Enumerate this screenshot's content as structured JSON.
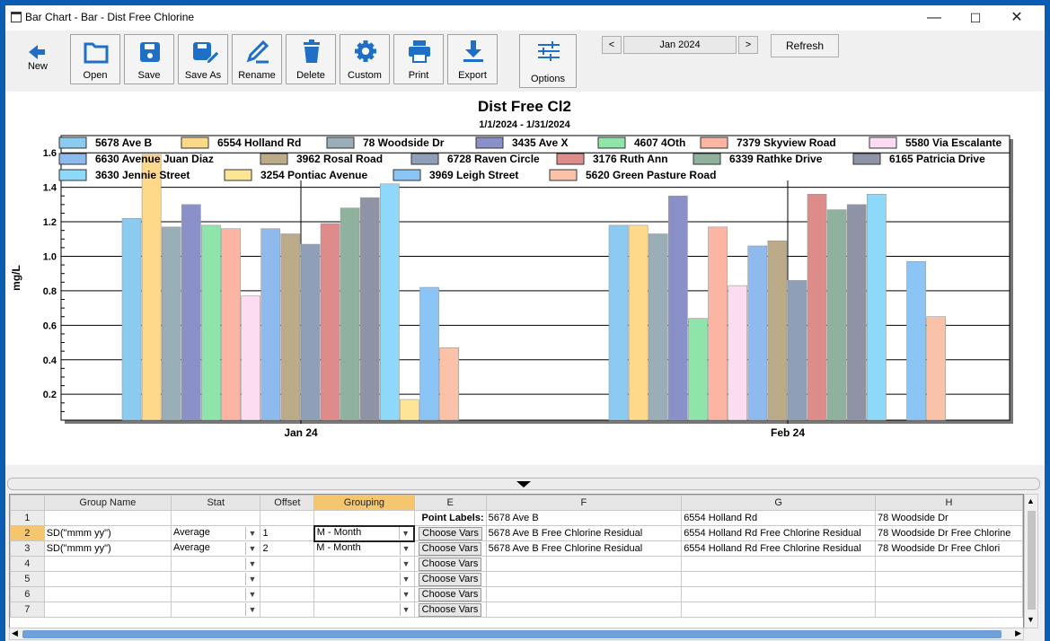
{
  "window": {
    "title": "Bar Chart - Bar - Dist Free Chlorine",
    "minimize": "—",
    "maximize": "☐",
    "close": "✕"
  },
  "toolbar": {
    "buttons": [
      {
        "label": "New",
        "icon": "arrow-left-icon"
      },
      {
        "label": "Open",
        "icon": "folder-icon"
      },
      {
        "label": "Save",
        "icon": "floppy-icon"
      },
      {
        "label": "Save As",
        "icon": "floppy-pencil-icon"
      },
      {
        "label": "Rename",
        "icon": "pencil-icon"
      },
      {
        "label": "Delete",
        "icon": "trash-icon"
      },
      {
        "label": "Custom",
        "icon": "gear-icon"
      },
      {
        "label": "Print",
        "icon": "printer-icon"
      },
      {
        "label": "Export",
        "icon": "download-icon"
      },
      {
        "label": "Options",
        "icon": "sliders-icon"
      }
    ],
    "prev_label": "<",
    "month": "Jan 2024",
    "next_label": ">",
    "refresh_label": "Refresh"
  },
  "colors": {
    "accent": "#1f6fc6",
    "header_selected": "#f6c66f"
  },
  "chart_data": {
    "type": "bar",
    "title": "Dist Free Cl2",
    "subtitle": "1/1/2024 - 1/31/2024",
    "ylabel": "mg/L",
    "ylim": [
      0.05,
      1.7
    ],
    "yticks": [
      "0.2",
      "0.4",
      "0.6",
      "0.8",
      "1.0",
      "1.2",
      "1.4",
      "1.6"
    ],
    "categories": [
      "Jan 24",
      "Feb 24"
    ],
    "legend_placement": "top",
    "grid": true,
    "series": [
      {
        "name": "5678 Ave B",
        "color": "#8ccbf0",
        "values": [
          1.22,
          1.18
        ]
      },
      {
        "name": "6554 Holland Rd",
        "color": "#fed98a",
        "values": [
          1.59,
          1.18
        ]
      },
      {
        "name": "78 Woodside Dr",
        "color": "#9aaeb7",
        "values": [
          1.17,
          1.13
        ]
      },
      {
        "name": "3435 Ave X",
        "color": "#8a90c8",
        "values": [
          1.3,
          1.35
        ]
      },
      {
        "name": "4607 4Oth",
        "color": "#8ee4a9",
        "values": [
          1.18,
          0.64
        ]
      },
      {
        "name": "7379 Skyview Road",
        "color": "#fbb5a2",
        "values": [
          1.16,
          1.17
        ]
      },
      {
        "name": "5580 Via Escalante",
        "color": "#fcdcf0",
        "values": [
          0.77,
          0.83
        ]
      },
      {
        "name": "6630 Avenue Juan Diaz",
        "color": "#8ebaee",
        "values": [
          1.16,
          1.06
        ]
      },
      {
        "name": "3962 Rosal Road",
        "color": "#bcab88",
        "values": [
          1.13,
          1.09
        ]
      },
      {
        "name": "6728 Raven Circle",
        "color": "#8f9fb8",
        "values": [
          1.07,
          0.86
        ]
      },
      {
        "name": "3176 Ruth Ann",
        "color": "#de8c8a",
        "values": [
          1.19,
          1.36
        ]
      },
      {
        "name": "6339 Rathke Drive",
        "color": "#8fb19d",
        "values": [
          1.28,
          1.27
        ]
      },
      {
        "name": "6165 Patricia Drive",
        "color": "#8f93a6",
        "values": [
          1.34,
          1.3
        ]
      },
      {
        "name": "3630 Jennie Street",
        "color": "#8ed8fa",
        "values": [
          1.42,
          1.36
        ]
      },
      {
        "name": "3254 Pontiac Avenue",
        "color": "#fde497",
        "values": [
          0.17,
          null
        ]
      },
      {
        "name": "3969 Leigh Street",
        "color": "#8bc5f6",
        "values": [
          0.82,
          0.97
        ]
      },
      {
        "name": "5620 Green Pasture Road",
        "color": "#fbc2aa",
        "values": [
          0.47,
          0.65
        ]
      }
    ]
  },
  "grid": {
    "columns": [
      "",
      "Group Name",
      "Stat",
      "Offset",
      "Grouping",
      "E",
      "F",
      "G",
      "H"
    ],
    "point_labels_label": "Point Labels:",
    "row1": {
      "F": "5678 Ave B",
      "G": "6554 Holland Rd",
      "H": "78 Woodside Dr"
    },
    "rows": [
      {
        "num": "2",
        "group": "SD(\"mmm yy\")",
        "stat": "Average",
        "offset": "1",
        "grouping": "M - Month",
        "vars": "Choose Vars",
        "F": "5678 Ave B Free Chlorine Residual",
        "G": "6554 Holland Rd Free Chlorine Residual",
        "H": "78 Woodside Dr Free Chlorine"
      },
      {
        "num": "3",
        "group": "SD(\"mmm yy\")",
        "stat": "Average",
        "offset": "2",
        "grouping": "M - Month",
        "vars": "Choose Vars",
        "F": "5678 Ave B Free Chlorine Residual",
        "G": "6554 Holland Rd Free Chlorine Residual",
        "H": "78 Woodside Dr Free Chlori"
      },
      {
        "num": "4",
        "group": "",
        "stat": "",
        "offset": "",
        "grouping": "",
        "vars": "Choose Vars",
        "F": "",
        "G": "",
        "H": ""
      },
      {
        "num": "5",
        "group": "",
        "stat": "",
        "offset": "",
        "grouping": "",
        "vars": "Choose Vars",
        "F": "",
        "G": "",
        "H": ""
      },
      {
        "num": "6",
        "group": "",
        "stat": "",
        "offset": "",
        "grouping": "",
        "vars": "Choose Vars",
        "F": "",
        "G": "",
        "H": ""
      },
      {
        "num": "7",
        "group": "",
        "stat": "",
        "offset": "",
        "grouping": "",
        "vars": "Choose Vars",
        "F": "",
        "G": "",
        "H": ""
      }
    ]
  }
}
